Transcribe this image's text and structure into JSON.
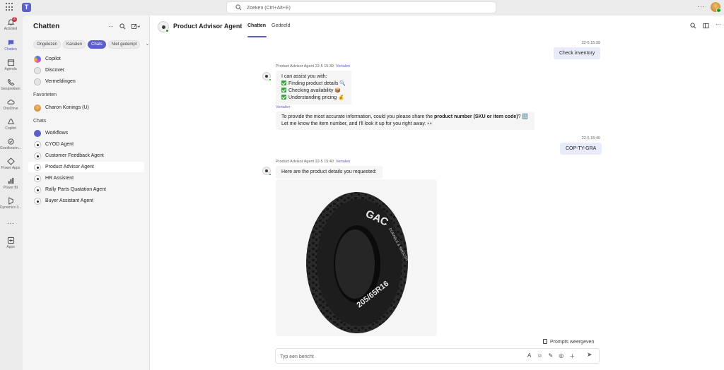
{
  "topbar": {
    "search_placeholder": "Zoeken (Ctrl+Alt+E)",
    "more": "···"
  },
  "rail": {
    "items": [
      {
        "label": "Activiteit",
        "badge": "2"
      },
      {
        "label": "Chatten"
      },
      {
        "label": "Agenda"
      },
      {
        "label": "Gesprekken"
      },
      {
        "label": "OneDrive"
      },
      {
        "label": "Copilot"
      },
      {
        "label": "Goedkeurin..."
      },
      {
        "label": "Power Apps"
      },
      {
        "label": "Power BI"
      },
      {
        "label": "Dynamics 3..."
      },
      {
        "label": "···"
      },
      {
        "label": "Apps"
      }
    ]
  },
  "sidebar": {
    "title": "Chatten",
    "filters": [
      "Ongelezen",
      "Kanalen",
      "Chats",
      "Niet gedempt"
    ],
    "top_items": [
      "Copilot",
      "Discover",
      "Vermeldingen"
    ],
    "favorites_header": "Favorieten",
    "favorites": [
      "Charon Konings (U)"
    ],
    "chats_header": "Chats",
    "chats": [
      "Workflows",
      "CYOD Agent",
      "Customer Feedback Agent",
      "Product Advisor Agent",
      "HR Assistent",
      "Rally Parts Quatation Agent",
      "Buyer Assistant Agent"
    ]
  },
  "header": {
    "title": "Product Advisor Agent",
    "tabs": [
      "Chatten",
      "Gedeeld"
    ]
  },
  "messages": {
    "out1": {
      "time": "22-5 15:39",
      "text": "Check inventory"
    },
    "in1": {
      "sender": "Product Advisor Agent",
      "time": "22-5 15:39",
      "translate": "Vertalen",
      "intro": "I can assist you with:",
      "list": [
        "Finding product details 🔍",
        "Checking availability 📦",
        "Understanding pricing 💰"
      ],
      "translate2": "Vertalen",
      "line1_pre": "To provide the most accurate information, could you please share the ",
      "line1_bold": "product number (SKU or item code)",
      "line1_post": "? 🔢",
      "line2": "Let me know the item number, and I'll look it up for you right away. 👀"
    },
    "out2": {
      "time": "22-5 15:40",
      "text": "COP-TY-GRA"
    },
    "in2": {
      "sender": "Product Advisor Agent",
      "time": "22-5 15:40",
      "translate": "Vertalen",
      "text": "Here are the product details you requested:",
      "tire_brand": "GAC",
      "tire_sub": "DURABLE & SMOOTH",
      "tire_size": "205/65R16"
    }
  },
  "composer": {
    "prompts_label": "Prompts weergeven",
    "placeholder": "Typ een bericht"
  },
  "colors": {
    "accent": "#5b5fc7",
    "presence": "#13a10e",
    "badge": "#c4314b"
  }
}
